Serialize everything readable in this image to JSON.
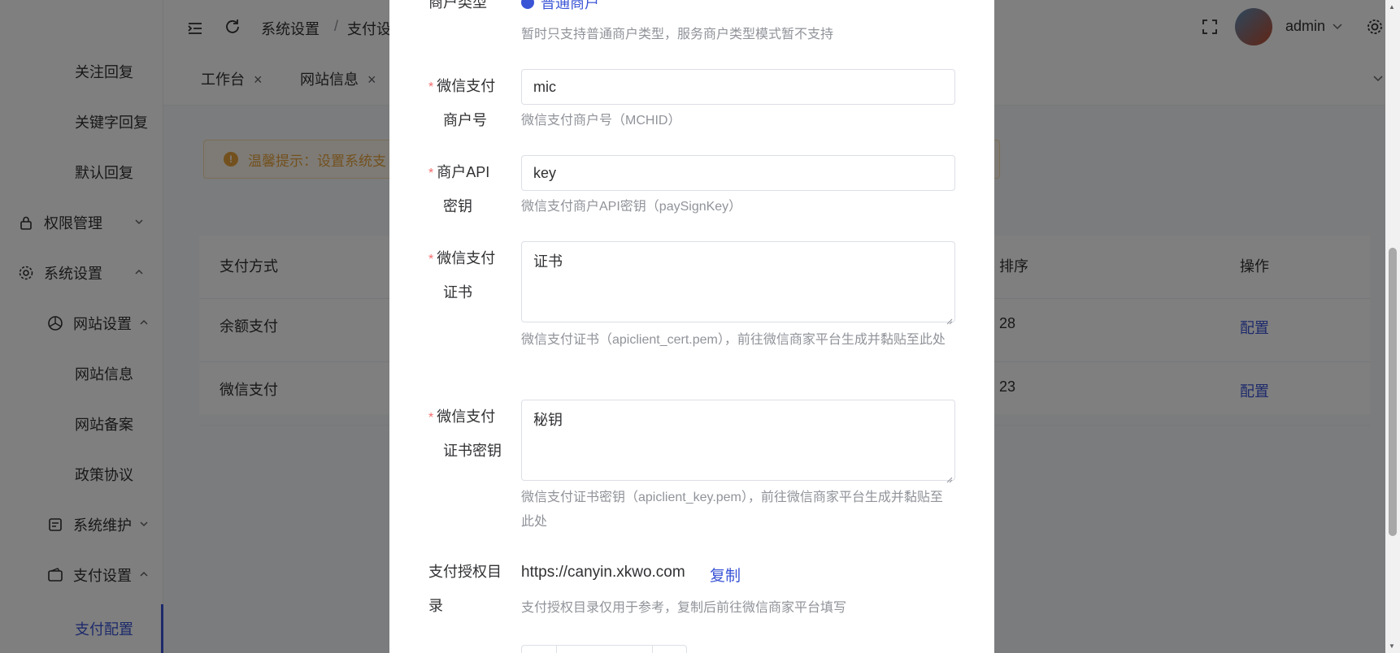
{
  "sidebar": {
    "items": [
      {
        "label": "关注回复"
      },
      {
        "label": "关键字回复"
      },
      {
        "label": "默认回复"
      },
      {
        "label": "权限管理"
      },
      {
        "label": "系统设置"
      },
      {
        "label": "网站设置"
      },
      {
        "label": "网站信息"
      },
      {
        "label": "网站备案"
      },
      {
        "label": "政策协议"
      },
      {
        "label": "系统维护"
      },
      {
        "label": "支付设置"
      },
      {
        "label": "支付配置"
      }
    ]
  },
  "header": {
    "breadcrumb": [
      "系统设置",
      "支付设"
    ],
    "separator": "/",
    "user": "admin"
  },
  "tabs": [
    {
      "label": "工作台"
    },
    {
      "label": "网站信息"
    }
  ],
  "alert": {
    "text": "温馨提示：设置系统支"
  },
  "table": {
    "headers": {
      "method": "支付方式",
      "sort": "排序",
      "action": "操作"
    },
    "rows": [
      {
        "method": "余额支付",
        "sort": "28",
        "action": "配置"
      },
      {
        "method": "微信支付",
        "sort": "23",
        "action": "配置"
      }
    ]
  },
  "modal": {
    "merchant_type": {
      "label": "商户类型",
      "option": "普通商户",
      "hint": "暂时只支持普通商户类型，服务商户类型模式暂不支持"
    },
    "mchid": {
      "label_line1": "微信支付",
      "label_line2": "商户号",
      "value": "mic",
      "hint": "微信支付商户号（MCHID）"
    },
    "api_key": {
      "label_line1": "商户API",
      "label_line2": "密钥",
      "value": "key",
      "hint": "微信支付商户API密钥（paySignKey）"
    },
    "cert": {
      "label_line1": "微信支付",
      "label_line2": "证书",
      "value": "证书",
      "hint": "微信支付证书（apiclient_cert.pem），前往微信商家平台生成并黏贴至此处"
    },
    "cert_key": {
      "label_line1": "微信支付",
      "label_line2": "证书密钥",
      "value": "秘钥",
      "hint": "微信支付证书密钥（apiclient_key.pem），前往微信商家平台生成并黏贴至此处"
    },
    "auth_dir": {
      "label_line1": "支付授权目",
      "label_line2": "录",
      "url": "https://canyin.xkwo.com",
      "copy_label": "复制",
      "hint": "支付授权目录仅用于参考，复制后前往微信商家平台填写"
    },
    "required_mark": "*"
  }
}
